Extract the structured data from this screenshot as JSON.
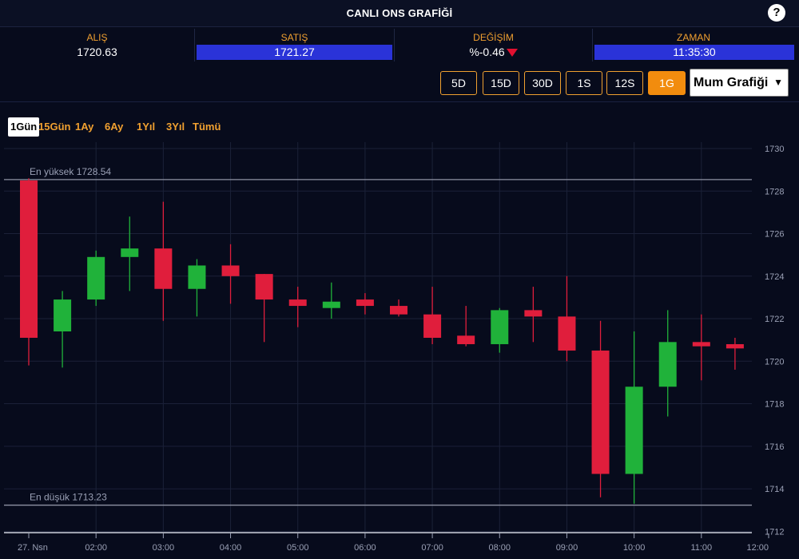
{
  "header": {
    "title": "CANLI ONS GRAFİĞİ",
    "help_label": "?"
  },
  "quotes": {
    "alis": {
      "label": "ALIŞ",
      "value": "1720.63"
    },
    "satis": {
      "label": "SATIŞ",
      "value": "1721.27"
    },
    "degisim": {
      "label": "DEĞİŞİM",
      "value": "%-0.46"
    },
    "zaman": {
      "label": "ZAMAN",
      "value": "11:35:30"
    }
  },
  "periods": [
    "5D",
    "15D",
    "30D",
    "1S",
    "12S",
    "1G"
  ],
  "active_period": "1G",
  "chart_type": {
    "selected": "Mum Grafiği"
  },
  "ranges": [
    "1Gün",
    "15Gün",
    "1Ay",
    "6Ay",
    "1Yıl",
    "3Yıl",
    "Tümü"
  ],
  "active_range": "1Gün",
  "colors": {
    "up": "#20b23a",
    "down": "#e01e3c",
    "accent": "#f28c0e",
    "background": "#070b1c",
    "highlight_blue": "#2a33d8"
  },
  "chart_data": {
    "type": "candlestick",
    "x_axis": {
      "labels": [
        "27. Nsn",
        "02:00",
        "03:00",
        "04:00",
        "05:00",
        "06:00",
        "07:00",
        "08:00",
        "09:00",
        "10:00",
        "11:00",
        "12:00"
      ],
      "range": [
        0,
        11
      ]
    },
    "y_axis": {
      "ticks": [
        1712,
        1714,
        1716,
        1718,
        1720,
        1722,
        1724,
        1726,
        1728,
        1730
      ],
      "range": [
        1711.9,
        1730.3
      ],
      "position": "right"
    },
    "grid": true,
    "reference_lines": [
      {
        "label": "En yüksek 1728.54",
        "value": 1728.54
      },
      {
        "label": "En düşük 1713.23",
        "value": 1713.23
      }
    ],
    "candles": [
      {
        "x": 0.0,
        "open": 1728.5,
        "high": 1728.6,
        "low": 1719.8,
        "close": 1721.1
      },
      {
        "x": 0.5,
        "open": 1721.4,
        "high": 1723.3,
        "low": 1719.7,
        "close": 1722.9
      },
      {
        "x": 1.0,
        "open": 1722.9,
        "high": 1725.2,
        "low": 1722.6,
        "close": 1724.9
      },
      {
        "x": 1.5,
        "open": 1724.9,
        "high": 1726.8,
        "low": 1723.3,
        "close": 1725.3
      },
      {
        "x": 2.0,
        "open": 1725.3,
        "high": 1727.5,
        "low": 1721.9,
        "close": 1723.4
      },
      {
        "x": 2.5,
        "open": 1723.4,
        "high": 1724.8,
        "low": 1722.1,
        "close": 1724.5
      },
      {
        "x": 3.0,
        "open": 1724.5,
        "high": 1725.5,
        "low": 1722.7,
        "close": 1724.0
      },
      {
        "x": 3.5,
        "open": 1724.1,
        "high": 1724.1,
        "low": 1720.9,
        "close": 1722.9
      },
      {
        "x": 4.0,
        "open": 1722.9,
        "high": 1723.5,
        "low": 1721.6,
        "close": 1722.6
      },
      {
        "x": 4.5,
        "open": 1722.5,
        "high": 1723.7,
        "low": 1722.0,
        "close": 1722.8
      },
      {
        "x": 5.0,
        "open": 1722.9,
        "high": 1723.2,
        "low": 1722.2,
        "close": 1722.6
      },
      {
        "x": 5.5,
        "open": 1722.6,
        "high": 1722.9,
        "low": 1722.1,
        "close": 1722.2
      },
      {
        "x": 6.0,
        "open": 1722.2,
        "high": 1723.5,
        "low": 1720.8,
        "close": 1721.1
      },
      {
        "x": 6.5,
        "open": 1721.2,
        "high": 1722.6,
        "low": 1720.7,
        "close": 1720.8
      },
      {
        "x": 7.0,
        "open": 1720.8,
        "high": 1722.5,
        "low": 1720.4,
        "close": 1722.4
      },
      {
        "x": 7.5,
        "open": 1722.4,
        "high": 1723.5,
        "low": 1720.9,
        "close": 1722.1
      },
      {
        "x": 8.0,
        "open": 1722.1,
        "high": 1724.0,
        "low": 1720.0,
        "close": 1720.5
      },
      {
        "x": 8.5,
        "open": 1720.5,
        "high": 1721.9,
        "low": 1713.6,
        "close": 1714.7
      },
      {
        "x": 9.0,
        "open": 1714.7,
        "high": 1721.4,
        "low": 1713.3,
        "close": 1718.8
      },
      {
        "x": 9.5,
        "open": 1718.8,
        "high": 1722.4,
        "low": 1717.4,
        "close": 1720.9
      },
      {
        "x": 10.0,
        "open": 1720.9,
        "high": 1722.2,
        "low": 1719.1,
        "close": 1720.7
      },
      {
        "x": 10.5,
        "open": 1720.8,
        "high": 1721.1,
        "low": 1719.6,
        "close": 1720.6
      }
    ]
  }
}
